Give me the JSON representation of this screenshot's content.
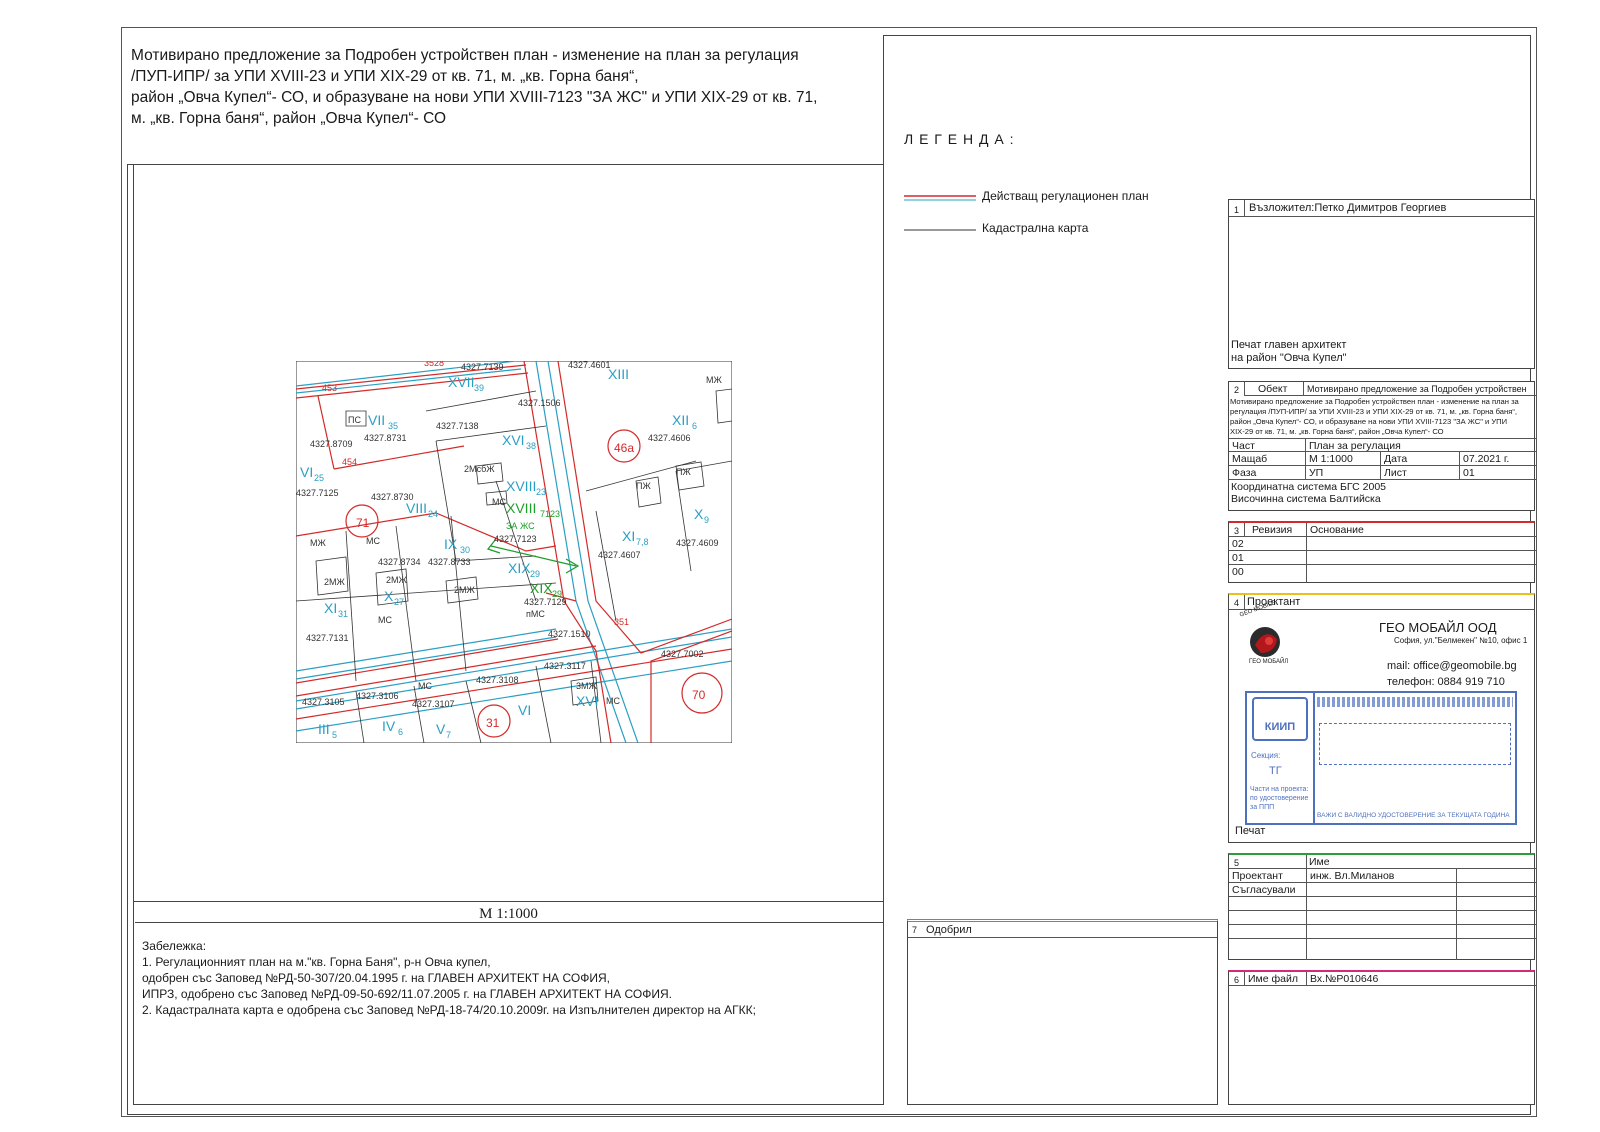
{
  "title": {
    "line1": "Мотивирано предложение за Подробен устройствен план - изменение на план за регулация",
    "line2": "/ПУП-ИПР/ за УПИ XVIII-23 и УПИ XIX-29  от кв. 71, м. „кв. Горна баня“,",
    "line3": "район „Овча Купел“- СО,  и образуване на нови УПИ XVIII-7123 \"ЗА ЖС\" и УПИ XIX-29  от кв. 71,",
    "line4": "м. „кв. Горна баня“, район „Овча Купел“- СО"
  },
  "scale_label": "M 1:1000",
  "notes": {
    "heading": "Забележка:",
    "l1": "1. Регулационният план на м.\"кв. Горна Баня\", р-н Овча купел,",
    "l2": "одобрен със Заповед №РД-50-307/20.04.1995 г. на ГЛАВЕН АРХИТЕКТ НА СОФИЯ,",
    "l3": "ИПРЗ, одобрено със Заповед №РД-09-50-692/11.07.2005 г. на ГЛАВЕН АРХИТЕКТ НА СОФИЯ.",
    "l4": "2. Кадастралната карта е одобрена със Заповед №РД-18-74/20.10.2009г. на Изпълнителен директор на АГКК;"
  },
  "legend": {
    "heading": "Л Е Г Е Н Д А :",
    "item1": "Действащ регулационен план",
    "item2": "Кадастрална карта",
    "color_regulation": "#d42a2a",
    "color_cadastre": "#2a9fc4"
  },
  "block1": {
    "num": "1",
    "label": "Възложител:Петко Димитров Георгиев",
    "stamp_l1": "Печат главен архитект",
    "stamp_l2": "на район \"Овча Купел\""
  },
  "block2": {
    "num": "2",
    "obj_label": "Обект",
    "obj_value": "Мотивирано предложение за Подробен устройствен",
    "desc_l1": "Мотивирано предложение за Подробен устройствен план - изменение на план за",
    "desc_l2": "регулация /ПУП-ИПР/ за УПИ XVIII-23 и УПИ XIX-29  от кв. 71, м. „кв. Горна баня“,",
    "desc_l3": "район „Овча Купел“- СО,  и образуване на нови УПИ XVIII-7123 \"ЗА ЖС\" и УПИ",
    "desc_l4": "XIX-29  от кв. 71, м. „кв. Горна баня“, район „Овча Купел“- СО",
    "part_label": "Част",
    "part_value": "План за регулация",
    "scale_label": "Мащаб",
    "scale_value": "М 1:1000",
    "date_label": "Дата",
    "date_value": "07.2021 г.",
    "phase_label": "Фаза",
    "phase_value": "УП",
    "sheet_label": "Лист",
    "sheet_value": "01",
    "coord": "Координатна система  БГС 2005",
    "height": "Височинна система Балтийска"
  },
  "block3": {
    "num": "3",
    "rev_label": "Ревизия",
    "basis_label": "Основание",
    "rows": [
      "02",
      "01",
      "00"
    ]
  },
  "block4": {
    "num": "4",
    "label": "Проектант",
    "company": "ГЕО МОБАЙЛ   ООД",
    "address": "София, ул.\"Белмекен\" №10, офис 1",
    "mail": "mail: office@geomobile.bg",
    "phone": "телефон:  0884 919 710",
    "logo_top": "GEO MOBILE",
    "logo_bottom": "ГЕО МОБАЙЛ",
    "stamp_org": "КИИП",
    "stamp_section_label": "Секция:",
    "stamp_section": "ТГ",
    "stamp_parts_l1": "Части на проекта:",
    "stamp_parts_l2": "по удостоверение",
    "stamp_parts_l3": "за ППП",
    "stamp_footer": "ВАЖИ С ВАЛИДНО УДОСТОВЕРЕНИЕ ЗА ТЕКУЩАТА ГОДИНА",
    "seal_label": "Печат"
  },
  "block5": {
    "num": "5",
    "name_label": "Име",
    "role1": "Проектант",
    "name1": "инж. Вл.Миланов",
    "role2": "Съгласували"
  },
  "block6": {
    "num": "6",
    "label": "Име файл",
    "value": "Вх.№Р010646"
  },
  "block7": {
    "num": "7",
    "label": "Одобрил"
  },
  "map": {
    "labels": [
      "4327.7139",
      "XVII",
      "39",
      "3528",
      "453",
      "454",
      "ПС",
      "VII",
      "35",
      "4327.8709",
      "4327.8731",
      "4327.7138",
      "XVI",
      "38",
      "4327.1506",
      "4327.4601",
      "XIII",
      "XII",
      "6",
      "4327.4606",
      "46а",
      "VI",
      "25",
      "4327.7125",
      "4327.8730",
      "VIII",
      "24",
      "71",
      "2МсбЖ",
      "МС",
      "XVIII",
      "23",
      "7123",
      "ЗА ЖС",
      "4327.7123",
      "XI",
      "7,8",
      "4327.4607",
      "ПЖ",
      "4327.4609",
      "X",
      "МЖ",
      "4327.8734",
      "2МЖ",
      "4327.8733",
      "IX",
      "30",
      "XIX",
      "29",
      "4327.7129",
      "пМС",
      "XI",
      "31",
      "4327.7131",
      "4327.1510",
      "351",
      "4327.7002",
      "70",
      "4327.3117",
      "4327.3108",
      "3МЖ",
      "XVI",
      "4327.3105",
      "4327.3106",
      "4327.3107",
      "III",
      "5",
      "IV",
      "6",
      "V",
      "7",
      "31",
      "VI"
    ]
  }
}
